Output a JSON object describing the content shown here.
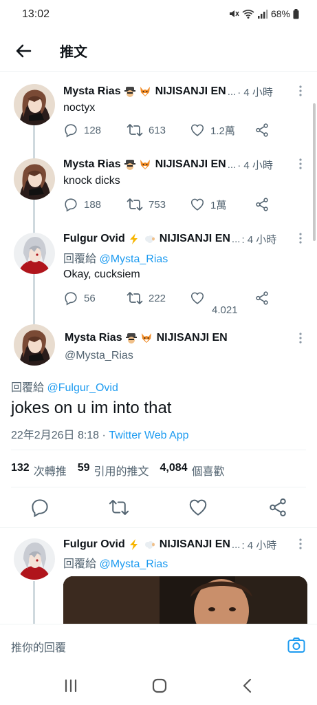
{
  "status_bar": {
    "time": "13:02",
    "battery": "68%"
  },
  "nav": {
    "title": "推文"
  },
  "tweets": [
    {
      "name": "Mysta Rias",
      "org": "NIJISANJI EN",
      "ellipsis": "...",
      "time": "· 4 小時",
      "text": "noctyx",
      "replies": "128",
      "retweets": "613",
      "likes": "1.2萬"
    },
    {
      "name": "Mysta Rias",
      "org": "NIJISANJI EN",
      "ellipsis": "...",
      "time": "· 4 小時",
      "text": "knock dicks",
      "replies": "188",
      "retweets": "753",
      "likes": "1萬"
    },
    {
      "name": "Fulgur Ovid",
      "org": "NIJISANJI EN",
      "ellipsis": "...",
      "time": ": 4 小時",
      "reply_prefix": "回覆給",
      "reply_to": "@Mysta_Rias",
      "text": "Okay, cucksiem",
      "replies": "56",
      "retweets": "222",
      "likes": "4.021"
    }
  ],
  "main_tweet": {
    "name": "Mysta Rias",
    "org": "NIJISANJI EN",
    "handle": "@Mysta_Rias",
    "reply_prefix": "回覆給",
    "reply_to": "@Fulgur_Ovid",
    "text": "jokes on u im into that",
    "date": "22年2月26日 8:18 ·",
    "source": "Twitter Web App",
    "retweets_count": "132",
    "retweets_label": "次轉推",
    "quotes_count": "59",
    "quotes_label": "引用的推文",
    "likes_count": "4,084",
    "likes_label": "個喜歡"
  },
  "reply_tweet": {
    "name": "Fulgur Ovid",
    "org": "NIJISANJI EN",
    "ellipsis": "...",
    "time": ": 4 小時",
    "reply_prefix": "回覆給",
    "reply_to": "@Mysta_Rias"
  },
  "reply_bar": {
    "placeholder": "推你的回覆"
  },
  "colors": {
    "accent": "#1d9bf0",
    "muted": "#536471",
    "text": "#0f1419"
  }
}
